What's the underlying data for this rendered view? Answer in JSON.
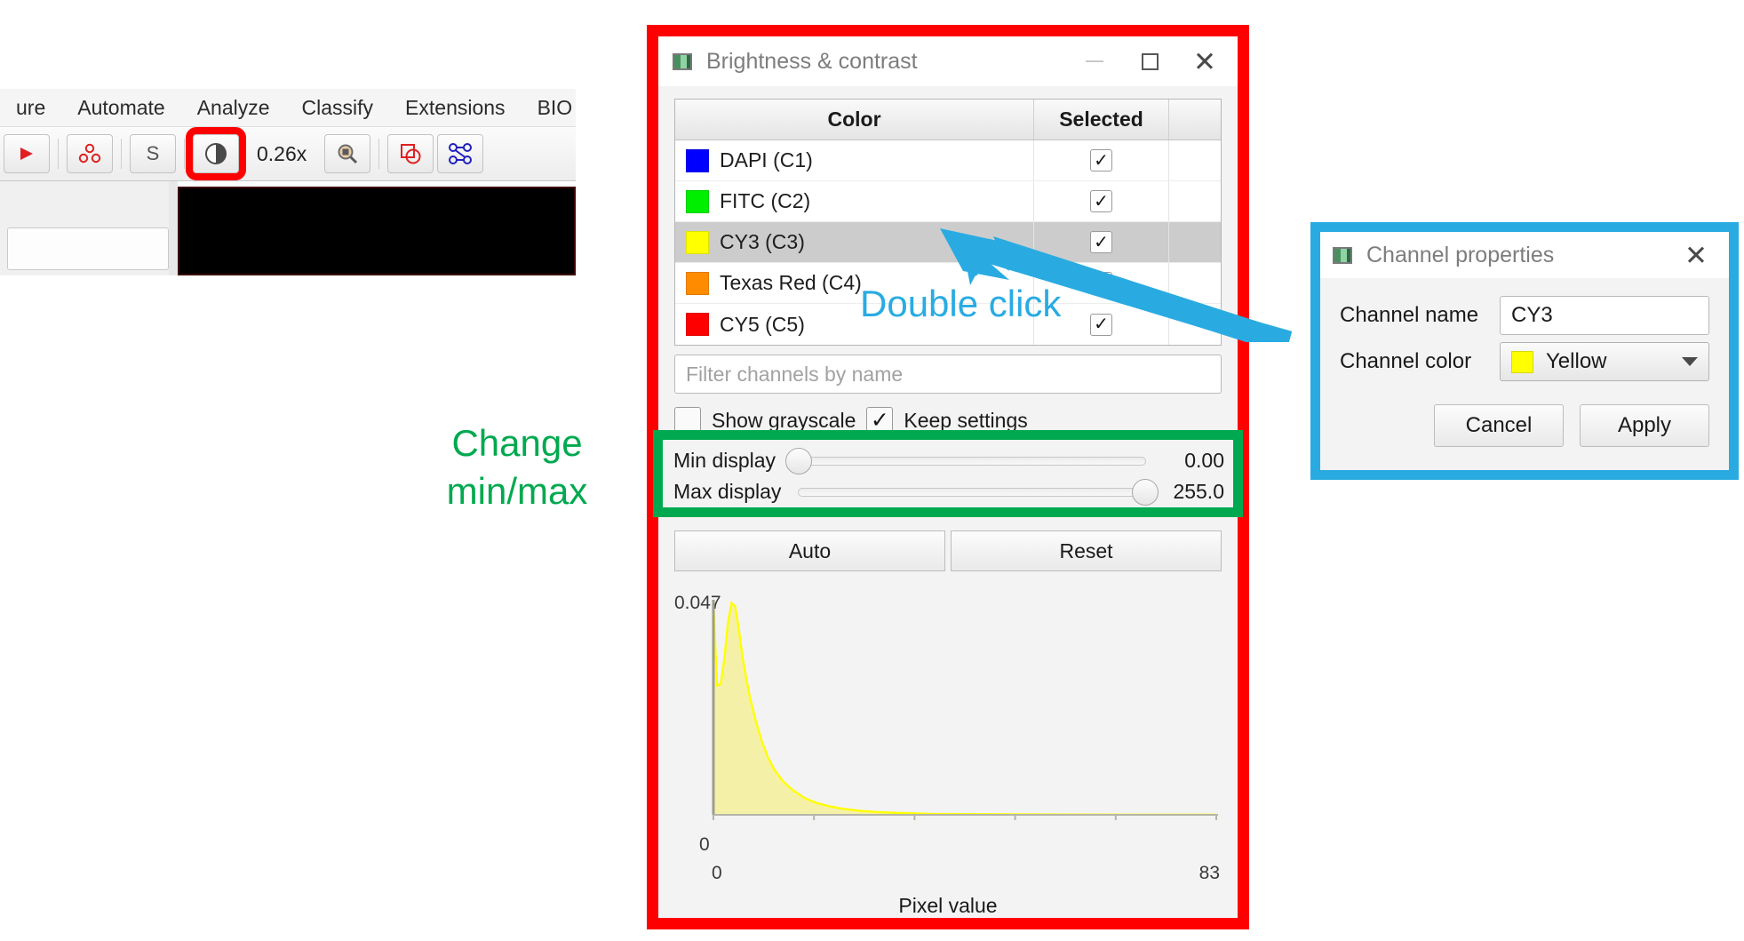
{
  "qupath": {
    "menus": [
      "ure",
      "Automate",
      "Analyze",
      "Classify",
      "Extensions",
      "BIO"
    ],
    "toolbar": {
      "arrow_icon": "arrow-icon",
      "cells_icon": "cells-icon",
      "script_label": "S",
      "contrast_icon": "brightness-contrast-icon",
      "zoom_level": "0.26x",
      "magnifier_icon": "magnifier-icon",
      "annotations_icon": "overlapping-shapes-icon",
      "nodes_icon": "connected-nodes-icon"
    }
  },
  "brightness_contrast": {
    "title": "Brightness & contrast",
    "window_icon": "app-window-icon",
    "minimize_label": "minimize-icon",
    "maximize_label": "maximize-icon",
    "close_label": "✕",
    "table": {
      "headers": [
        "Color",
        "Selected",
        ""
      ],
      "rows": [
        {
          "name": "DAPI (C1)",
          "color": "#0000FF",
          "selected": true,
          "highlighted": false
        },
        {
          "name": "FITC (C2)",
          "color": "#00EE00",
          "selected": true,
          "highlighted": false
        },
        {
          "name": "CY3 (C3)",
          "color": "#FFFF00",
          "selected": true,
          "highlighted": true
        },
        {
          "name": "Texas Red (C4)",
          "color": "#FF8C00",
          "selected": true,
          "highlighted": false
        },
        {
          "name": "CY5 (C5)",
          "color": "#FF0000",
          "selected": true,
          "highlighted": false
        }
      ],
      "check_glyph": "✓"
    },
    "filter": {
      "placeholder": "Filter channels by name",
      "value": ""
    },
    "options": {
      "show_grayscale_label": "Show grayscale",
      "show_grayscale_checked": false,
      "keep_settings_label": "Keep settings",
      "keep_settings_checked": true,
      "check_glyph": "✓"
    },
    "sliders": {
      "min_label": "Min display",
      "min_value": "0.00",
      "min_percent": 0,
      "max_label": "Max display",
      "max_value": "255.0",
      "max_percent": 100
    },
    "buttons": {
      "auto": "Auto",
      "reset": "Reset"
    }
  },
  "chart_data": {
    "type": "area",
    "title": "",
    "xlabel": "Pixel value",
    "ylabel": "",
    "xlim": [
      0,
      83
    ],
    "ylim": [
      0,
      0.047
    ],
    "y_max_label": "0.047",
    "y_min_label": "0",
    "x_min_label": "0",
    "x_max_label": "83",
    "x_ticks": [
      0,
      16.6,
      33.2,
      49.8,
      66.4,
      83
    ],
    "line_color": "#FFFF00",
    "fill_color": "#F5F0A8",
    "grid": false,
    "legend": "none",
    "x": [
      0,
      0.6,
      1.2,
      1.8,
      2.4,
      3.0,
      3.6,
      4.2,
      4.8,
      5.4,
      6.0,
      7.0,
      8.0,
      9.0,
      10.0,
      11.5,
      13.0,
      15.0,
      17.0,
      19.0,
      21.0,
      24.0,
      27.0,
      31.0,
      36.0,
      42.0,
      50.0,
      60.0,
      70.0,
      83.0
    ],
    "y": [
      0.0465,
      0.0283,
      0.0286,
      0.034,
      0.042,
      0.0463,
      0.0455,
      0.0405,
      0.0345,
      0.03,
      0.0258,
      0.0205,
      0.016,
      0.0126,
      0.01,
      0.0073,
      0.0055,
      0.0037,
      0.0026,
      0.0019,
      0.0014,
      0.0009,
      0.0006,
      0.0004,
      0.0002,
      0.00015,
      0.0001,
      6e-05,
      4e-05,
      3e-05
    ]
  },
  "channel_properties": {
    "title": "Channel properties",
    "window_icon": "app-window-icon",
    "close_label": "✕",
    "name_label": "Channel name",
    "name_value": "CY3",
    "color_label": "Channel color",
    "color_value": "Yellow",
    "color_hex": "#FFFF00",
    "cancel_label": "Cancel",
    "apply_label": "Apply"
  },
  "annotations": {
    "change_minmax": "Change\nmin/max",
    "change_minmax_line1": "Change",
    "change_minmax_line2": "min/max",
    "double_click": "Double click",
    "green_color": "#00a94f",
    "blue_color": "#29abe2",
    "red_color": "#ff0000"
  }
}
